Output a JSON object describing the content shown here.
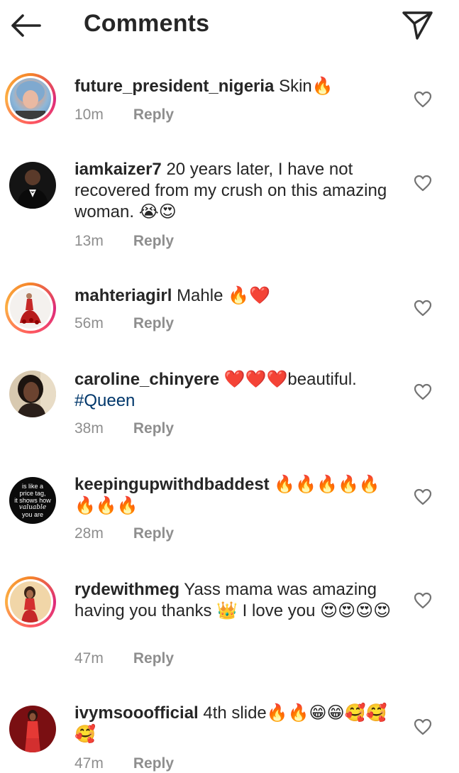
{
  "header": {
    "title": "Comments",
    "back_icon": "arrow-left-icon",
    "share_icon": "paper-plane-icon"
  },
  "comments": [
    {
      "username": "future_president_nigeria",
      "text": "Skin🔥",
      "time": "10m",
      "reply": "Reply"
    },
    {
      "username": "iamkaizer7",
      "text": "20 years later, I have not recovered from my crush on this amazing woman. 😭😍",
      "time": "13m",
      "reply": "Reply"
    },
    {
      "username": "mahteriagirl",
      "text": "Mahle 🔥❤️",
      "time": "56m",
      "reply": "Reply"
    },
    {
      "username": "caroline_chinyere",
      "text": "❤️❤️❤️beautiful.",
      "hashtag": "#Queen",
      "time": "38m",
      "reply": "Reply"
    },
    {
      "username": "keepingupwithdbaddest",
      "text": "🔥🔥🔥🔥🔥🔥🔥🔥",
      "time": "28m",
      "reply": "Reply",
      "avatar_text": [
        "is like a",
        "price tag,",
        "it shows how",
        "valuable",
        "you are"
      ]
    },
    {
      "username": "rydewithmeg",
      "text": "Yass mama was amazing having you thanks 👑 I love you 😍😍😍😍",
      "time": "47m",
      "reply": "Reply"
    },
    {
      "username": "ivymsooofficial",
      "text": "4th slide🔥🔥😁😁🥰🥰🥰",
      "time": "47m",
      "reply": "Reply"
    }
  ],
  "colors": {
    "story_ring": [
      "#f58529",
      "#dd2a7b",
      "#fcaf45"
    ],
    "meta_gray": "#8e8e8e",
    "hashtag_blue": "#00376b"
  }
}
